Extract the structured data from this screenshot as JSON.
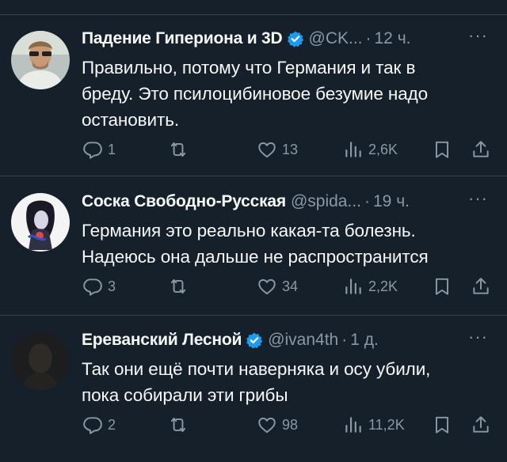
{
  "tweets": [
    {
      "name": "Падение Гипериона и 3D",
      "verified": true,
      "handle": "@CK...",
      "dot": "·",
      "time": "12 ч.",
      "more": "···",
      "lines": [
        "Правильно, потому что Германия и так в",
        "бреду. Это псилоцибиновое безумие надо",
        "остановить."
      ],
      "replies": "1",
      "retweets": "",
      "likes": "13",
      "views": "2,6K"
    },
    {
      "name": "Соска Свободно-Русская",
      "verified": false,
      "handle": "@spida...",
      "dot": "·",
      "time": "19 ч.",
      "more": "···",
      "lines": [
        "Германия это реально какая-та болезнь.",
        "Надеюсь она дальше не распространится"
      ],
      "replies": "3",
      "retweets": "",
      "likes": "34",
      "views": "2,2K"
    },
    {
      "name": "Ереванский Лесной",
      "verified": true,
      "handle": "@ivan4th",
      "dot": "·",
      "time": "1 д.",
      "more": "···",
      "lines": [
        "Так они ещё почти наверняка и осу убили,",
        "пока собирали эти грибы"
      ],
      "replies": "2",
      "retweets": "",
      "likes": "98",
      "views": "11,2K"
    }
  ],
  "colors": {
    "background": "#15202b",
    "secondary": "#8b98a5",
    "verified": "#1d9bf0",
    "separator": "#38444d"
  }
}
